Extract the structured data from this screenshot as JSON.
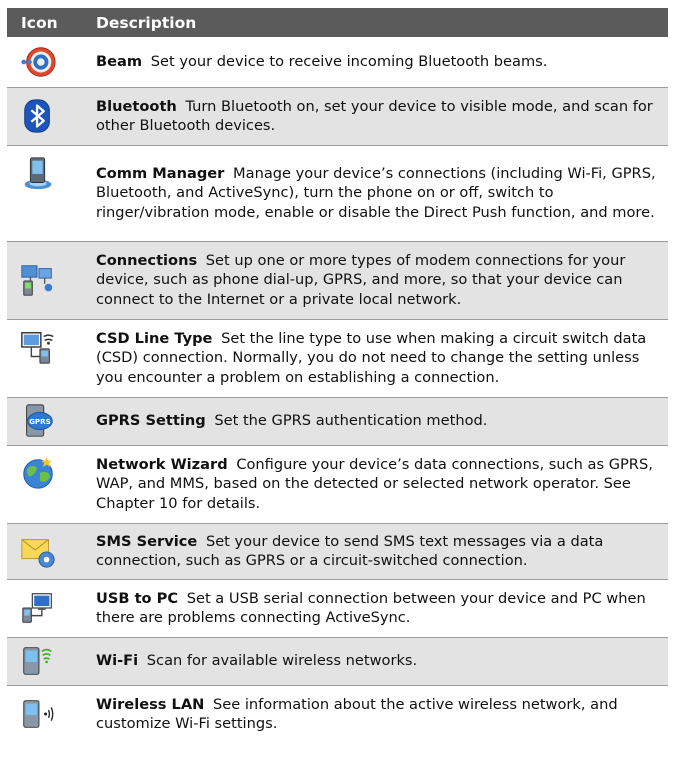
{
  "headers": {
    "icon": "Icon",
    "description": "Description"
  },
  "rows": [
    {
      "icon": "beam-icon",
      "name": "Beam",
      "text": "Set your device to receive incoming Bluetooth beams."
    },
    {
      "icon": "bluetooth-icon",
      "name": "Bluetooth",
      "text": "Turn Bluetooth on, set your device to visible mode, and scan for other Bluetooth devices."
    },
    {
      "icon": "comm-manager-icon",
      "name": "Comm Manager",
      "text": "Manage your device’s connections (including Wi-Fi, GPRS, Bluetooth, and ActiveSync), turn the phone on or off, switch to ringer/vibration mode, enable or disable the Direct Push function, and more."
    },
    {
      "icon": "connections-icon",
      "name": "Connections",
      "text": "Set up one or more types of modem connections for your device, such as phone dial-up, GPRS, and more, so that your device can connect to the Internet or a private local network."
    },
    {
      "icon": "csd-line-type-icon",
      "name": "CSD Line Type",
      "text": "Set the line type to use when making a circuit switch data (CSD) connection. Normally, you do not need to change the setting unless you encounter a problem on establishing a connection."
    },
    {
      "icon": "gprs-setting-icon",
      "name": "GPRS Setting",
      "text": "Set the GPRS authentication method."
    },
    {
      "icon": "network-wizard-icon",
      "name": "Network Wizard",
      "text": "Configure your device’s data connections, such as GPRS, WAP, and MMS, based on the detected or selected network operator. See Chapter 10 for details."
    },
    {
      "icon": "sms-service-icon",
      "name": "SMS Service",
      "text": "Set your device to send SMS text messages via a data connection, such as GPRS or a circuit-switched connection."
    },
    {
      "icon": "usb-to-pc-icon",
      "name": "USB to PC",
      "text": "Set a USB serial connection between your device and PC when there are problems connecting ActiveSync."
    },
    {
      "icon": "wifi-icon",
      "name": "Wi-Fi",
      "text": "Scan for available wireless networks."
    },
    {
      "icon": "wireless-lan-icon",
      "name": "Wireless LAN",
      "text": "See information about the active wireless network, and customize Wi-Fi settings."
    }
  ],
  "gprs_badge": "GPRS",
  "colors": {
    "header_bg": "#5b5b5b",
    "alt_row_bg": "#e3e3e3",
    "divider": "#9b9b9b"
  }
}
